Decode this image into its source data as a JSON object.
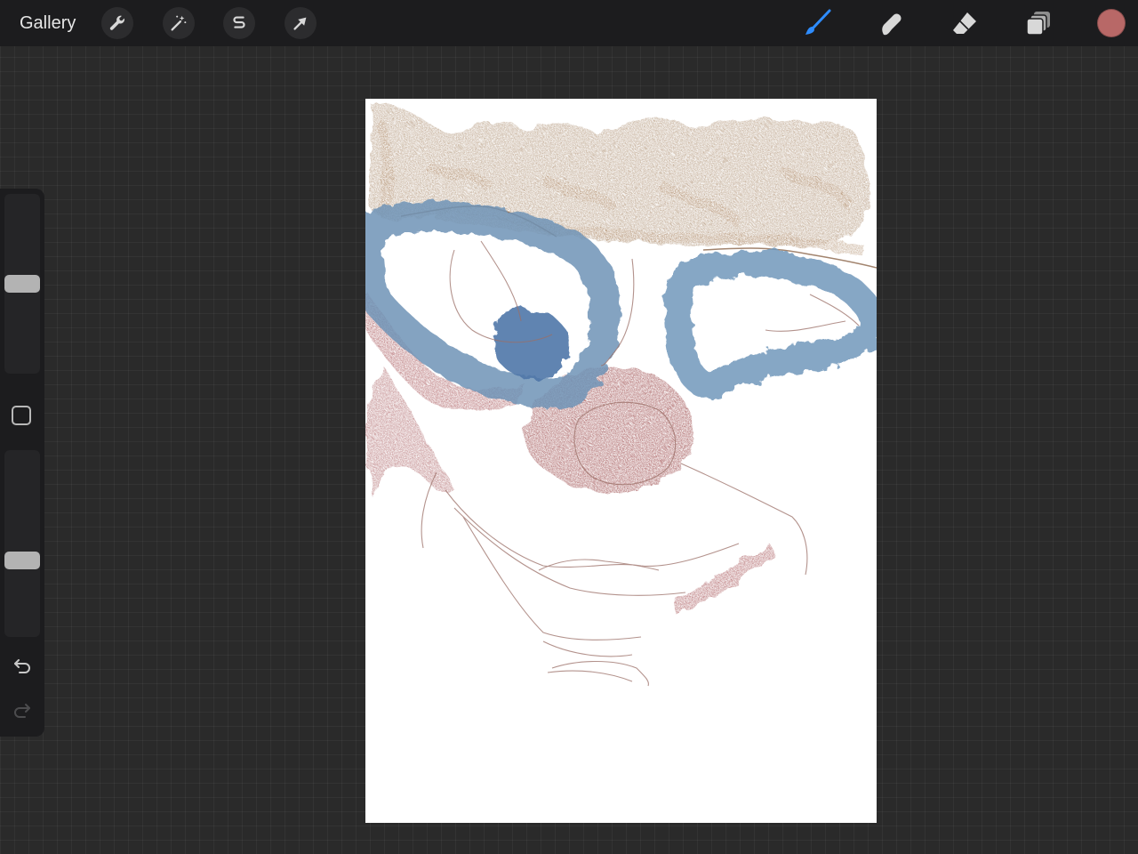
{
  "topbar": {
    "gallery_label": "Gallery",
    "actions_icon": "wrench-icon",
    "adjustments_icon": "magic-wand-icon",
    "selection_icon": "selection-s-icon",
    "transform_icon": "arrow-cursor-icon",
    "brush_icon": "brush-icon",
    "smudge_icon": "smudge-finger-icon",
    "eraser_icon": "eraser-icon",
    "layers_icon": "layers-icon",
    "active_tool": "brush",
    "current_color": "#b86867"
  },
  "sidebar": {
    "size_slider_level": 0.5,
    "opacity_slider_level": 0.4,
    "undo_icon": "undo-icon",
    "redo_icon": "redo-icon",
    "redo_enabled": false
  },
  "canvas": {
    "palette": {
      "hair": "#a88a6a",
      "glasses": "#6f93b6",
      "skin_red": "#9c4b4d",
      "sketch": "#9a6e66"
    }
  },
  "colors": {
    "accent_blue": "#2e8cff",
    "toolbar_bg": "#1c1c1e",
    "workspace_bg": "#2a2a2a"
  }
}
